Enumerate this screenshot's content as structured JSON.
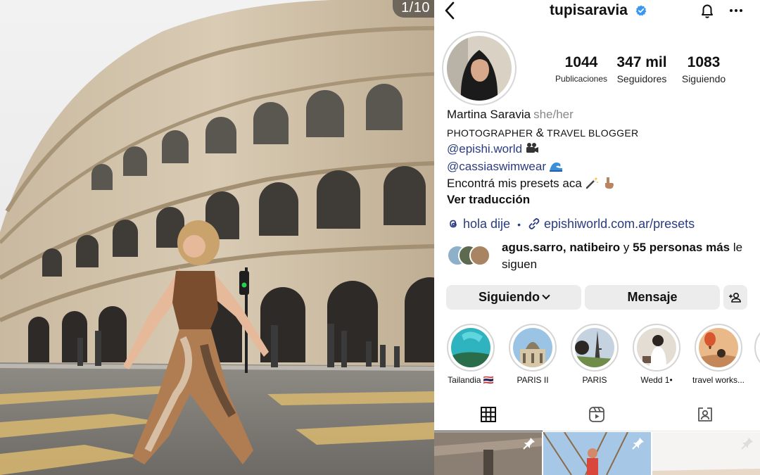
{
  "photo": {
    "counter": "1/10"
  },
  "profile": {
    "username": "tupisaravia",
    "icons": {
      "back": "chevron-left-icon",
      "verified": "verified-badge-icon",
      "notifications": "bell-icon",
      "more": "more-dots-icon"
    },
    "accent_color": "#3897f0",
    "link_color": "#2a3c7f",
    "stats": {
      "posts_value": "1044",
      "posts_label": "Publicaciones",
      "followers_value": "347 mil",
      "followers_label": "Seguidores",
      "following_value": "1083",
      "following_label": "Siguiendo"
    },
    "bio": {
      "name": "Martina Saravia",
      "pronouns": "she/her",
      "line2_a": "PHOTOGRAPHER",
      "line2_amp": "&",
      "line2_b": "TRAVEL BLOGGER",
      "mention1": "@epishi.world",
      "mention2": "@cassiaswimwear",
      "line5": "Encontrá mis presets aca",
      "translate": "Ver traducción"
    },
    "links": {
      "threads": "hola dije",
      "url": "epishiworld.com.ar/presets"
    },
    "followed_by": {
      "names": "agus.sarro, natibeiro",
      "connector": "y",
      "others": "55 personas más",
      "suffix": "le siguen"
    },
    "buttons": {
      "following": "Siguiendo",
      "message": "Mensaje"
    },
    "highlights": [
      {
        "label": "Tailandia 🇹🇭"
      },
      {
        "label": "PARIS II"
      },
      {
        "label": "PARIS"
      },
      {
        "label": "Wedd 1•"
      },
      {
        "label": "travel works..."
      }
    ],
    "tabs": [
      "grid-icon",
      "reels-icon",
      "tagged-icon"
    ]
  }
}
